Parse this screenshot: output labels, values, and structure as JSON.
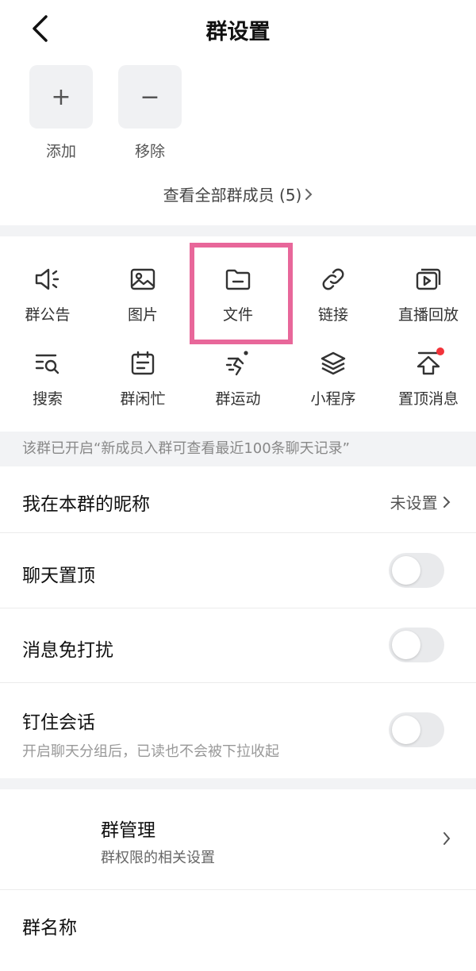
{
  "header": {
    "title": "群设置"
  },
  "members": {
    "add_label": "添加",
    "remove_label": "移除",
    "add_symbol": "+",
    "remove_symbol": "−",
    "view_all": "查看全部群成员 (5)"
  },
  "features": [
    {
      "label": "群公告",
      "icon": "megaphone-icon"
    },
    {
      "label": "图片",
      "icon": "image-icon"
    },
    {
      "label": "文件",
      "icon": "folder-icon"
    },
    {
      "label": "链接",
      "icon": "link-icon"
    },
    {
      "label": "直播回放",
      "icon": "video-replay-icon"
    },
    {
      "label": "搜索",
      "icon": "search-list-icon"
    },
    {
      "label": "群闲忙",
      "icon": "calendar-icon"
    },
    {
      "label": "群运动",
      "icon": "running-icon"
    },
    {
      "label": "小程序",
      "icon": "layers-icon"
    },
    {
      "label": "置顶消息",
      "icon": "pin-top-icon"
    }
  ],
  "notice": "该群已开启“新成员入群可查看最近100条聊天记录”",
  "settings": {
    "nickname": {
      "label": "我在本群的昵称",
      "value": "未设置"
    },
    "pin_chat": {
      "label": "聊天置顶"
    },
    "mute": {
      "label": "消息免打扰"
    },
    "pin_session": {
      "label": "钉住会话",
      "sub": "开启聊天分组后，已读也不会被下拉收起"
    },
    "manage": {
      "label": "群管理",
      "sub": "群权限的相关设置"
    },
    "group_name": {
      "label": "群名称"
    }
  },
  "colors": {
    "highlight": "#e8679a",
    "badge": "#f2333a",
    "separator": "#f2f3f5"
  }
}
